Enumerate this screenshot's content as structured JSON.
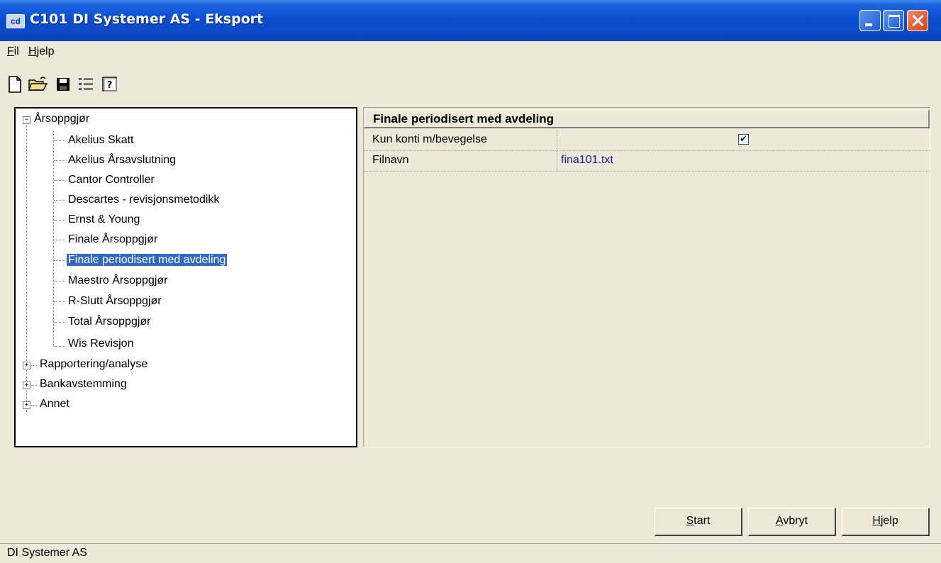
{
  "window": {
    "icon_text": "cd",
    "title": "C101 DI Systemer AS - Eksport"
  },
  "menu": {
    "items": [
      {
        "mnemonic": "F",
        "rest": "il"
      },
      {
        "mnemonic": "H",
        "rest": "jelp"
      }
    ]
  },
  "toolbar": {
    "icons": [
      "new-document-icon",
      "open-folder-icon",
      "save-icon",
      "list-icon",
      "help-icon"
    ]
  },
  "tree": {
    "groups": [
      {
        "label": "Årsoppgjør",
        "expanded": true,
        "children": [
          "Akelius Skatt",
          "Akelius Årsavslutning",
          "Cantor Controller",
          "Descartes - revisjonsmetodikk",
          "Ernst & Young",
          "Finale Årsoppgjør",
          "Finale periodisert med avdeling",
          "Maestro Årsoppgjør",
          "R-Slutt Årsoppgjør",
          "Total Årsoppgjør",
          "Wis Revisjon"
        ],
        "selected_child": "Finale periodisert med avdeling"
      },
      {
        "label": "Rapportering/analyse",
        "expanded": false
      },
      {
        "label": "Bankavstemming",
        "expanded": false
      },
      {
        "label": "Annet",
        "expanded": false
      }
    ]
  },
  "properties": {
    "header": "Finale periodisert med avdeling",
    "rows": [
      {
        "label": "Kun konti m/bevegelse",
        "type": "checkbox",
        "checked": true
      },
      {
        "label": "Filnavn",
        "type": "text",
        "value": "fina101.txt"
      }
    ]
  },
  "buttons": {
    "start": {
      "mnemonic": "S",
      "rest": "tart"
    },
    "cancel": {
      "mnemonic": "A",
      "rest": "vbryt"
    },
    "help": {
      "mnemonic": "H",
      "rest": "jelp"
    }
  },
  "status": {
    "text": "DI Systemer AS"
  },
  "colors": {
    "title_bar": "#0a4ed0",
    "selection": "#316ac5",
    "window_bg": "#ece9d8",
    "value_text": "#1a1a8c"
  }
}
